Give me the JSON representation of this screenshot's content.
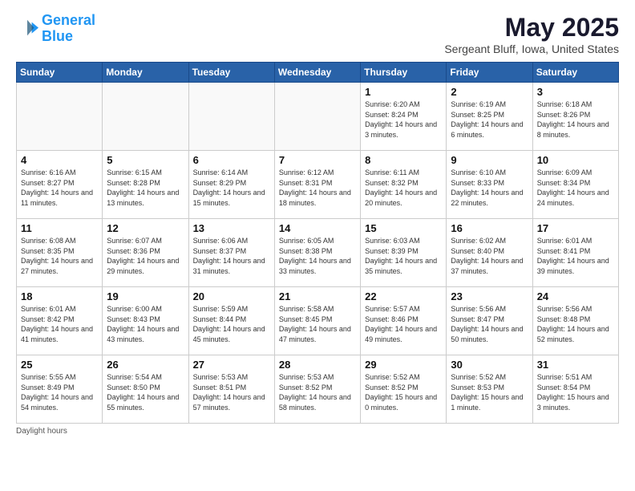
{
  "header": {
    "logo_line1": "General",
    "logo_line2": "Blue",
    "month": "May 2025",
    "location": "Sergeant Bluff, Iowa, United States"
  },
  "days_of_week": [
    "Sunday",
    "Monday",
    "Tuesday",
    "Wednesday",
    "Thursday",
    "Friday",
    "Saturday"
  ],
  "footer": {
    "label": "Daylight hours"
  },
  "weeks": [
    [
      {
        "day": "",
        "info": ""
      },
      {
        "day": "",
        "info": ""
      },
      {
        "day": "",
        "info": ""
      },
      {
        "day": "",
        "info": ""
      },
      {
        "day": "1",
        "info": "Sunrise: 6:20 AM\nSunset: 8:24 PM\nDaylight: 14 hours\nand 3 minutes."
      },
      {
        "day": "2",
        "info": "Sunrise: 6:19 AM\nSunset: 8:25 PM\nDaylight: 14 hours\nand 6 minutes."
      },
      {
        "day": "3",
        "info": "Sunrise: 6:18 AM\nSunset: 8:26 PM\nDaylight: 14 hours\nand 8 minutes."
      }
    ],
    [
      {
        "day": "4",
        "info": "Sunrise: 6:16 AM\nSunset: 8:27 PM\nDaylight: 14 hours\nand 11 minutes."
      },
      {
        "day": "5",
        "info": "Sunrise: 6:15 AM\nSunset: 8:28 PM\nDaylight: 14 hours\nand 13 minutes."
      },
      {
        "day": "6",
        "info": "Sunrise: 6:14 AM\nSunset: 8:29 PM\nDaylight: 14 hours\nand 15 minutes."
      },
      {
        "day": "7",
        "info": "Sunrise: 6:12 AM\nSunset: 8:31 PM\nDaylight: 14 hours\nand 18 minutes."
      },
      {
        "day": "8",
        "info": "Sunrise: 6:11 AM\nSunset: 8:32 PM\nDaylight: 14 hours\nand 20 minutes."
      },
      {
        "day": "9",
        "info": "Sunrise: 6:10 AM\nSunset: 8:33 PM\nDaylight: 14 hours\nand 22 minutes."
      },
      {
        "day": "10",
        "info": "Sunrise: 6:09 AM\nSunset: 8:34 PM\nDaylight: 14 hours\nand 24 minutes."
      }
    ],
    [
      {
        "day": "11",
        "info": "Sunrise: 6:08 AM\nSunset: 8:35 PM\nDaylight: 14 hours\nand 27 minutes."
      },
      {
        "day": "12",
        "info": "Sunrise: 6:07 AM\nSunset: 8:36 PM\nDaylight: 14 hours\nand 29 minutes."
      },
      {
        "day": "13",
        "info": "Sunrise: 6:06 AM\nSunset: 8:37 PM\nDaylight: 14 hours\nand 31 minutes."
      },
      {
        "day": "14",
        "info": "Sunrise: 6:05 AM\nSunset: 8:38 PM\nDaylight: 14 hours\nand 33 minutes."
      },
      {
        "day": "15",
        "info": "Sunrise: 6:03 AM\nSunset: 8:39 PM\nDaylight: 14 hours\nand 35 minutes."
      },
      {
        "day": "16",
        "info": "Sunrise: 6:02 AM\nSunset: 8:40 PM\nDaylight: 14 hours\nand 37 minutes."
      },
      {
        "day": "17",
        "info": "Sunrise: 6:01 AM\nSunset: 8:41 PM\nDaylight: 14 hours\nand 39 minutes."
      }
    ],
    [
      {
        "day": "18",
        "info": "Sunrise: 6:01 AM\nSunset: 8:42 PM\nDaylight: 14 hours\nand 41 minutes."
      },
      {
        "day": "19",
        "info": "Sunrise: 6:00 AM\nSunset: 8:43 PM\nDaylight: 14 hours\nand 43 minutes."
      },
      {
        "day": "20",
        "info": "Sunrise: 5:59 AM\nSunset: 8:44 PM\nDaylight: 14 hours\nand 45 minutes."
      },
      {
        "day": "21",
        "info": "Sunrise: 5:58 AM\nSunset: 8:45 PM\nDaylight: 14 hours\nand 47 minutes."
      },
      {
        "day": "22",
        "info": "Sunrise: 5:57 AM\nSunset: 8:46 PM\nDaylight: 14 hours\nand 49 minutes."
      },
      {
        "day": "23",
        "info": "Sunrise: 5:56 AM\nSunset: 8:47 PM\nDaylight: 14 hours\nand 50 minutes."
      },
      {
        "day": "24",
        "info": "Sunrise: 5:56 AM\nSunset: 8:48 PM\nDaylight: 14 hours\nand 52 minutes."
      }
    ],
    [
      {
        "day": "25",
        "info": "Sunrise: 5:55 AM\nSunset: 8:49 PM\nDaylight: 14 hours\nand 54 minutes."
      },
      {
        "day": "26",
        "info": "Sunrise: 5:54 AM\nSunset: 8:50 PM\nDaylight: 14 hours\nand 55 minutes."
      },
      {
        "day": "27",
        "info": "Sunrise: 5:53 AM\nSunset: 8:51 PM\nDaylight: 14 hours\nand 57 minutes."
      },
      {
        "day": "28",
        "info": "Sunrise: 5:53 AM\nSunset: 8:52 PM\nDaylight: 14 hours\nand 58 minutes."
      },
      {
        "day": "29",
        "info": "Sunrise: 5:52 AM\nSunset: 8:52 PM\nDaylight: 15 hours\nand 0 minutes."
      },
      {
        "day": "30",
        "info": "Sunrise: 5:52 AM\nSunset: 8:53 PM\nDaylight: 15 hours\nand 1 minute."
      },
      {
        "day": "31",
        "info": "Sunrise: 5:51 AM\nSunset: 8:54 PM\nDaylight: 15 hours\nand 3 minutes."
      }
    ]
  ]
}
